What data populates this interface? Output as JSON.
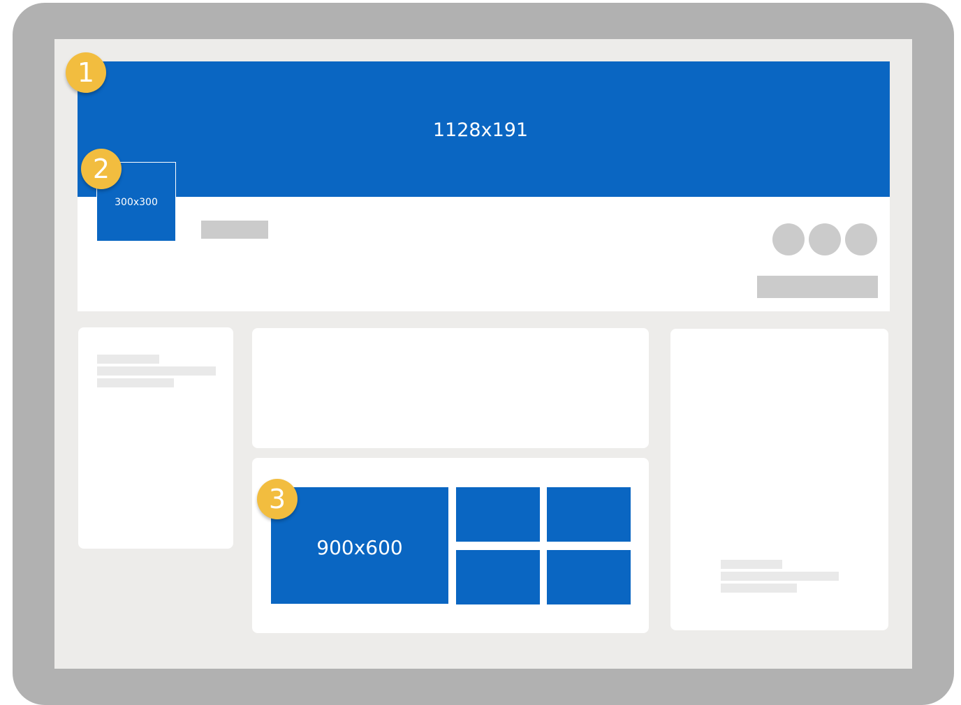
{
  "cover": {
    "size_label": "1128x191",
    "badge": "1"
  },
  "profile_photo": {
    "size_label": "300x300",
    "badge": "2"
  },
  "post_image": {
    "size_label": "900x600",
    "badge": "3"
  },
  "colors": {
    "brand_blue": "#0a66c2",
    "badge_yellow": "#f2bd3f",
    "device_frame": "#b1b1b1",
    "screen_bg": "#edecea"
  },
  "icons": [
    "action-circle-icon",
    "action-circle-icon",
    "action-circle-icon"
  ]
}
